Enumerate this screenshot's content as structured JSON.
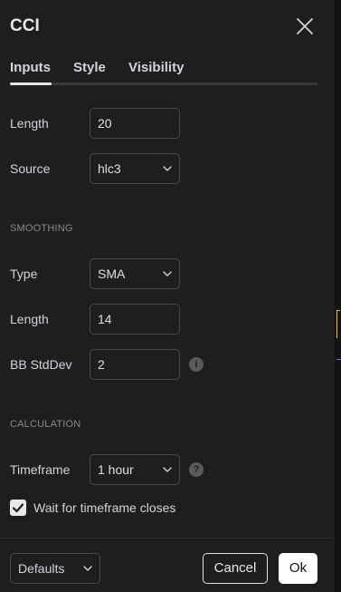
{
  "dialog": {
    "title": "CCI",
    "close_icon": "close-icon"
  },
  "tabs": [
    {
      "label": "Inputs",
      "active": true
    },
    {
      "label": "Style",
      "active": false
    },
    {
      "label": "Visibility",
      "active": false
    }
  ],
  "inputs": {
    "length": {
      "label": "Length",
      "value": "20"
    },
    "source": {
      "label": "Source",
      "value": "hlc3"
    }
  },
  "smoothing": {
    "section_label": "SMOOTHING",
    "type": {
      "label": "Type",
      "value": "SMA"
    },
    "length": {
      "label": "Length",
      "value": "14"
    },
    "bb_stddev": {
      "label": "BB StdDev",
      "value": "2",
      "info_icon": "i"
    }
  },
  "calculation": {
    "section_label": "CALCULATION",
    "timeframe": {
      "label": "Timeframe",
      "value": "1 hour",
      "help_icon": "?"
    },
    "wait_closes": {
      "label": "Wait for timeframe closes",
      "checked": true
    }
  },
  "footer": {
    "defaults_label": "Defaults",
    "cancel_label": "Cancel",
    "ok_label": "Ok"
  },
  "colors": {
    "background": "#1e1e1e",
    "text": "#d1d4dc",
    "border": "#4a4a4a",
    "accent": "#ffffff"
  }
}
